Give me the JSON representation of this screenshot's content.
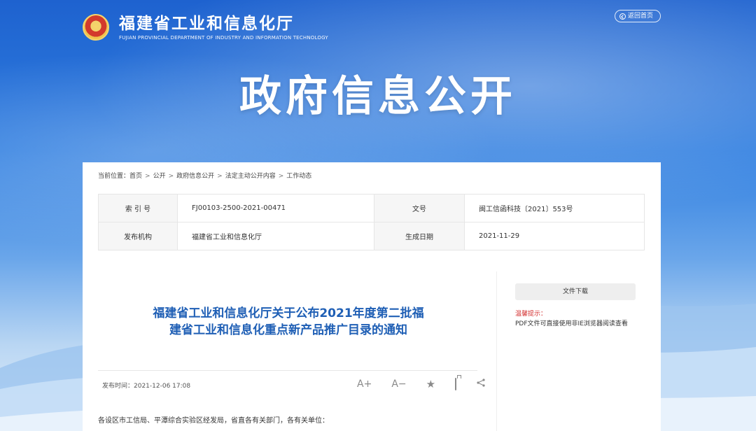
{
  "header": {
    "site_title": "福建省工业和信息化厅",
    "site_subtitle": "FUJIAN PROVINCIAL DEPARTMENT OF INDUSTRY AND INFORMATION TECHNOLOGY",
    "return_home": "返回首页"
  },
  "banner": {
    "title": "政府信息公开"
  },
  "breadcrumb": {
    "prefix": "当前位置：",
    "items": [
      "首页",
      "公开",
      "政府信息公开",
      "法定主动公开内容",
      "工作动态"
    ]
  },
  "meta": {
    "index_label": "索 引 号",
    "index_value": "FJ00103-2500-2021-00471",
    "doc_no_label": "文号",
    "doc_no_value": "闽工信函科技〔2021〕553号",
    "issuer_label": "发布机构",
    "issuer_value": "福建省工业和信息化厅",
    "date_label": "生成日期",
    "date_value": "2021-11-29"
  },
  "article": {
    "title": "福建省工业和信息化厅关于公布2021年度第二批福建省工业和信息化重点新产品推广目录的通知",
    "publish_time": "发布时间：2021-12-06 17:08",
    "font_increase": "A+",
    "font_decrease": "A−",
    "greeting": "各设区市工信局、平潭综合实验区经发局，省直各有关部门，各有关单位："
  },
  "sidebar": {
    "download_label": "文件下载",
    "tip_title": "温馨提示：",
    "tip_text": "PDF文件可直接使用非IE浏览器阅读查看"
  }
}
